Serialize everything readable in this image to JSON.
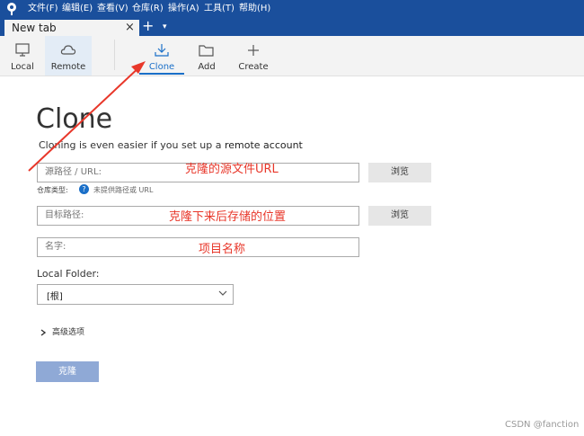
{
  "menubar": {
    "items": [
      "文件(F)",
      "编辑(E)",
      "查看(V)",
      "仓库(R)",
      "操作(A)",
      "工具(T)",
      "帮助(H)"
    ]
  },
  "tabs": {
    "active_title": "New tab",
    "close_glyph": "×",
    "add_glyph": "+",
    "dropdown_glyph": "▾"
  },
  "toolbar": {
    "local_label": "Local",
    "remote_label": "Remote",
    "clone_label": "Clone",
    "add_label": "Add",
    "create_label": "Create"
  },
  "page": {
    "heading": "Clone",
    "subtitle_text": "Cloning is even easier if you set up a ",
    "subtitle_link": "remote account"
  },
  "form": {
    "source_placeholder": "源路径 / URL:",
    "target_placeholder": "目标路径:",
    "name_placeholder": "名字:",
    "browse_label": "浏览",
    "repo_type_label": "仓库类型:",
    "repo_type_help": "?",
    "repo_type_value": "未提供路径或 URL",
    "local_folder_label": "Local Folder:",
    "local_folder_value": "[根]",
    "advanced_label": "高级选项",
    "clone_button": "克隆"
  },
  "annotations": {
    "source_note": "克隆的源文件URL",
    "target_note": "克隆下来后存储的位置",
    "name_note": "项目名称",
    "color": "#e8372a"
  },
  "watermark": "CSDN @fanction",
  "colors": {
    "menubar": "#1a4f9c",
    "accent": "#1a6fc8",
    "clone_button": "#8fa9d6"
  }
}
